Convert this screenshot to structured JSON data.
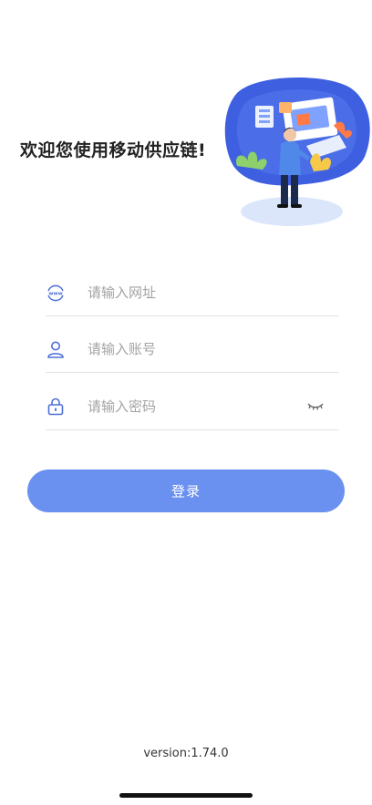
{
  "welcome_title": "欢迎您使用移动供应链!",
  "hero": {
    "illustration": "person-at-computer-illustration"
  },
  "form": {
    "url": {
      "placeholder": "请输入网址",
      "icon": "globe-www-icon",
      "value": ""
    },
    "account": {
      "placeholder": "请输入账号",
      "icon": "user-icon",
      "value": ""
    },
    "password": {
      "placeholder": "请输入密码",
      "icon": "lock-icon",
      "value": "",
      "toggle_icon": "eye-closed-icon"
    }
  },
  "login_button": "登录",
  "version": "version:1.74.0",
  "colors": {
    "accent": "#6a90f0",
    "icon": "#4f6fd6",
    "placeholder": "#a3a3a3",
    "divider": "#e3e3e3"
  }
}
